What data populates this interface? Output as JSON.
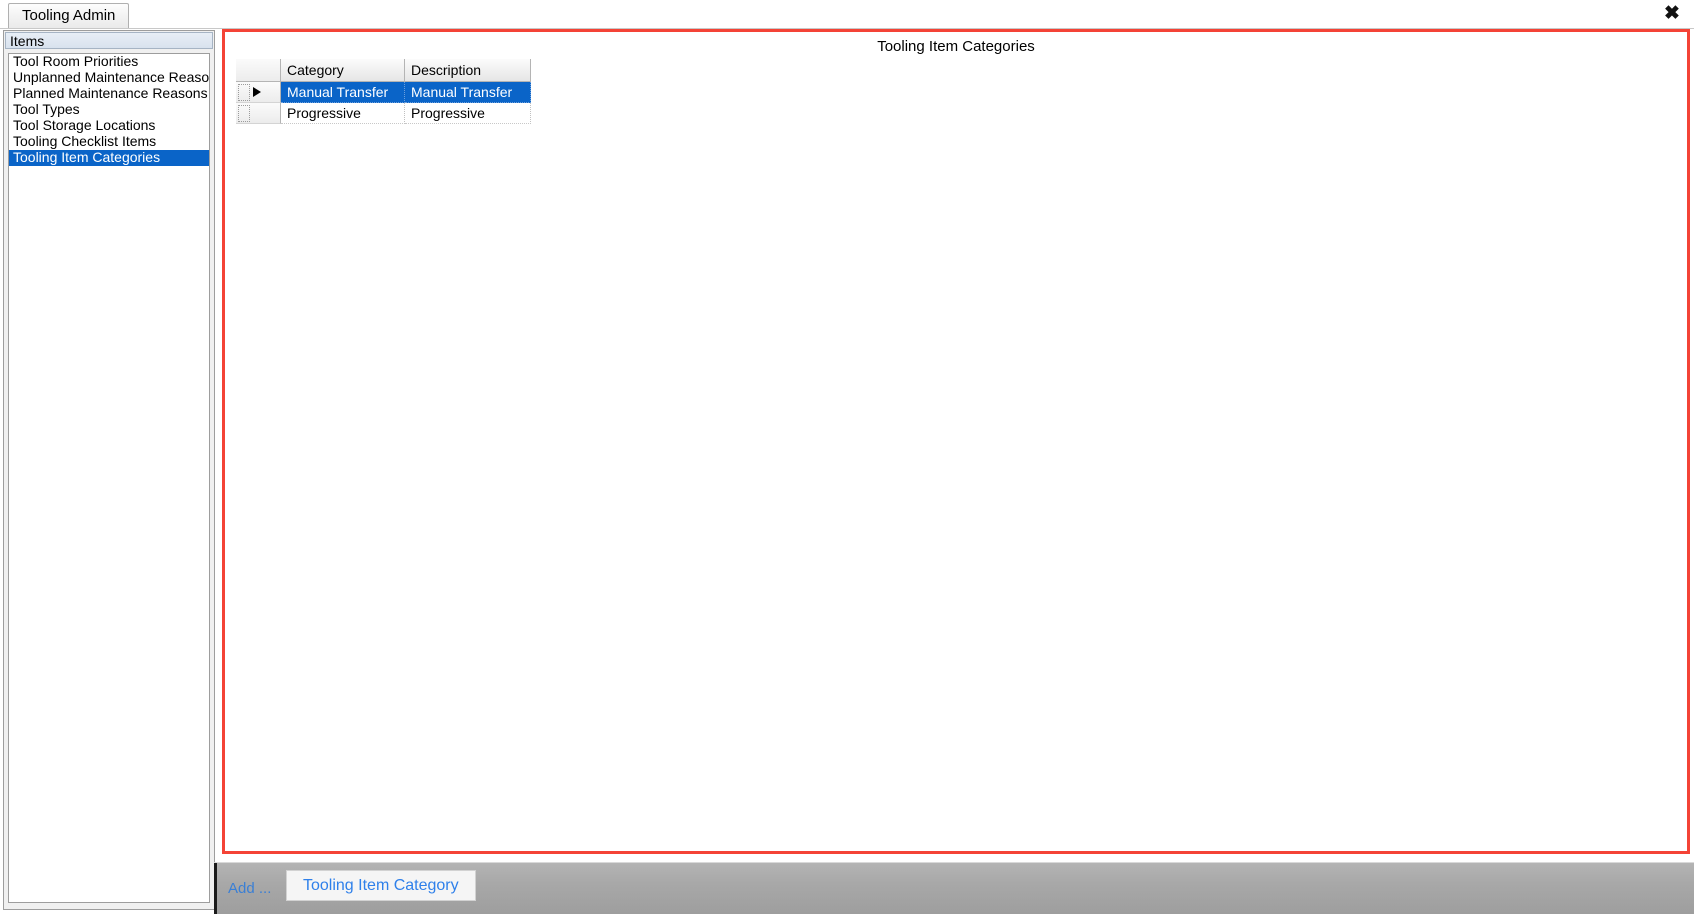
{
  "window": {
    "close_icon": "close-icon",
    "close_glyph": "✖"
  },
  "tabs": [
    {
      "label": "Tooling Admin",
      "active": true
    }
  ],
  "sidebar": {
    "header": "Items",
    "items": [
      {
        "label": "Tool Room Priorities",
        "selected": false
      },
      {
        "label": "Unplanned Maintenance Reasons",
        "selected": false
      },
      {
        "label": "Planned Maintenance Reasons",
        "selected": false
      },
      {
        "label": "Tool Types",
        "selected": false
      },
      {
        "label": "Tool Storage Locations",
        "selected": false
      },
      {
        "label": "Tooling Checklist Items",
        "selected": false
      },
      {
        "label": "Tooling Item Categories",
        "selected": true
      }
    ]
  },
  "panel": {
    "title": "Tooling Item Categories",
    "border_color": "#f44336"
  },
  "grid": {
    "columns": [
      "Category",
      "Description"
    ],
    "rows": [
      {
        "category": "Manual Transfer",
        "description": "Manual Transfer",
        "selected": true,
        "current": true
      },
      {
        "category": "Progressive",
        "description": "Progressive",
        "selected": false,
        "current": false
      }
    ],
    "selection_color": "#0a64c8"
  },
  "actionbar": {
    "add_label": "Add ...",
    "add_button_label": "Tooling Item Category",
    "link_color": "#2f80ea"
  }
}
